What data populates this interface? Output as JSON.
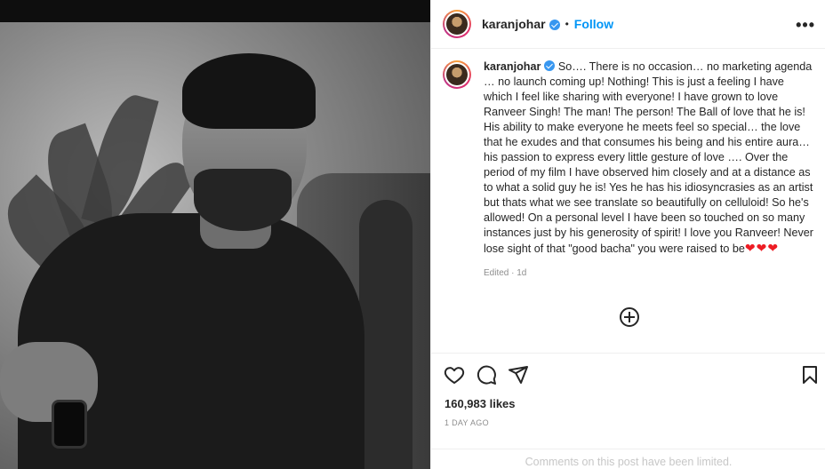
{
  "post": {
    "username": "karanjohar",
    "follow_label": "Follow",
    "separator": "•",
    "more_label": "•••",
    "caption_text": "So…. There is no occasion… no marketing agenda … no launch coming up! Nothing! This is just a feeling I have which I feel like sharing with everyone! I have grown to love Ranveer Singh! The man! The person! The Ball of love that he is! His ability to make everyone he meets feel so special… the love that he exudes and that consumes his being and his entire aura… his passion to express every little gesture of love …. Over the period of my film I have observed him closely and at a distance as to what a solid guy he is! Yes he has his idiosyncrasies as an artist but thats what we see translate so beautifully on celluloid! So he's allowed! On a personal level I have been so touched on so many instances just by his generosity of spirit! I love you Ranveer! Never lose sight of that \"good bacha\" you were raised to be",
    "caption_hearts": "❤❤❤",
    "edited_label": "Edited · 1d",
    "likes": "160,983 likes",
    "time_ago": "1 DAY AGO",
    "comments_limited": "Comments on this post have been limited."
  },
  "icons": {
    "verified": "verified-badge-icon",
    "like": "heart-icon",
    "comment": "comment-icon",
    "share": "share-icon",
    "save": "bookmark-icon",
    "add_comment": "plus-circle-icon"
  },
  "colors": {
    "accent": "#0095f6",
    "verified": "#3897f0",
    "heart": "#ed1c24",
    "muted": "#8e8e8e"
  }
}
